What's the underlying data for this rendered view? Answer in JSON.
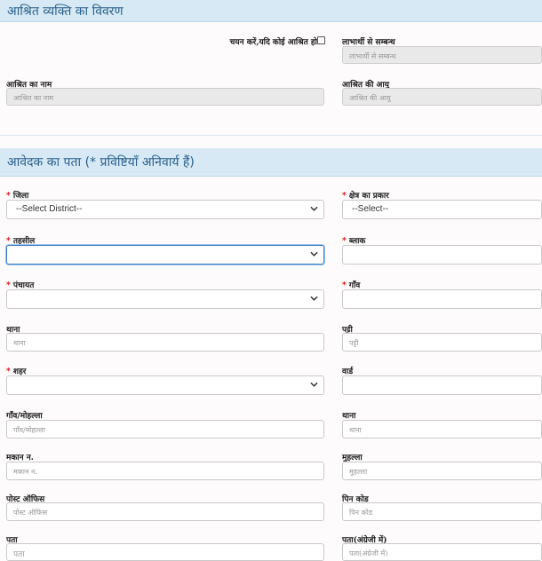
{
  "section1": {
    "title": "आश्रित व्यक्ति का विवरण",
    "checkbox_label": "चयन करें,यदि कोई आश्रित हो",
    "relation": {
      "label": "लाभार्थी से सम्बन्ध",
      "placeholder": "लाभार्थी से सम्बन्ध"
    },
    "dep_name": {
      "label": "आश्रित का नाम",
      "placeholder": "आश्रित का नाम"
    },
    "dep_age": {
      "label": "आश्रित की आयु",
      "placeholder": "आश्रित की आयु"
    }
  },
  "section2": {
    "title": "आवेदक का पता (* प्रविष्टियाँ अनिवार्य हैं)",
    "required_mark": "*",
    "district": {
      "label": "जिला",
      "value": "--Select District--"
    },
    "area_type": {
      "label": "क्षेत्र का प्रकार",
      "value": "--Select--"
    },
    "tehsil": {
      "label": "तहसील",
      "value": ""
    },
    "block": {
      "label": "ब्लाक",
      "placeholder": ""
    },
    "panchayat": {
      "label": "पंचायत",
      "value": ""
    },
    "village": {
      "label": "गाँव",
      "placeholder": ""
    },
    "police_station": {
      "label": "थाना",
      "placeholder": "थाना"
    },
    "patti": {
      "label": "पट्टी",
      "placeholder": "पट्टी"
    },
    "city": {
      "label": "शहर",
      "value": ""
    },
    "ward": {
      "label": "वार्ड",
      "placeholder": ""
    },
    "village_mohalla": {
      "label": "गाँव/मोहल्ला",
      "placeholder": "गाँव/मोहल्ला"
    },
    "police_station2": {
      "label": "थाना",
      "placeholder": "थाना"
    },
    "house_no": {
      "label": "मकान न.",
      "placeholder": "मकान न."
    },
    "mohalla": {
      "label": "मुहल्ला",
      "placeholder": "मुहल्ला"
    },
    "post_office": {
      "label": "पोस्ट ऑफिस",
      "placeholder": "पोस्ट ऑफिस"
    },
    "pin_code": {
      "label": "पिन कोड",
      "placeholder": "पिन कोड"
    },
    "address": {
      "label": "पता",
      "placeholder": "पता"
    },
    "address_en": {
      "label": "पता(अंग्रेजी में)",
      "placeholder": "पता(अंग्रेजी में)"
    }
  }
}
